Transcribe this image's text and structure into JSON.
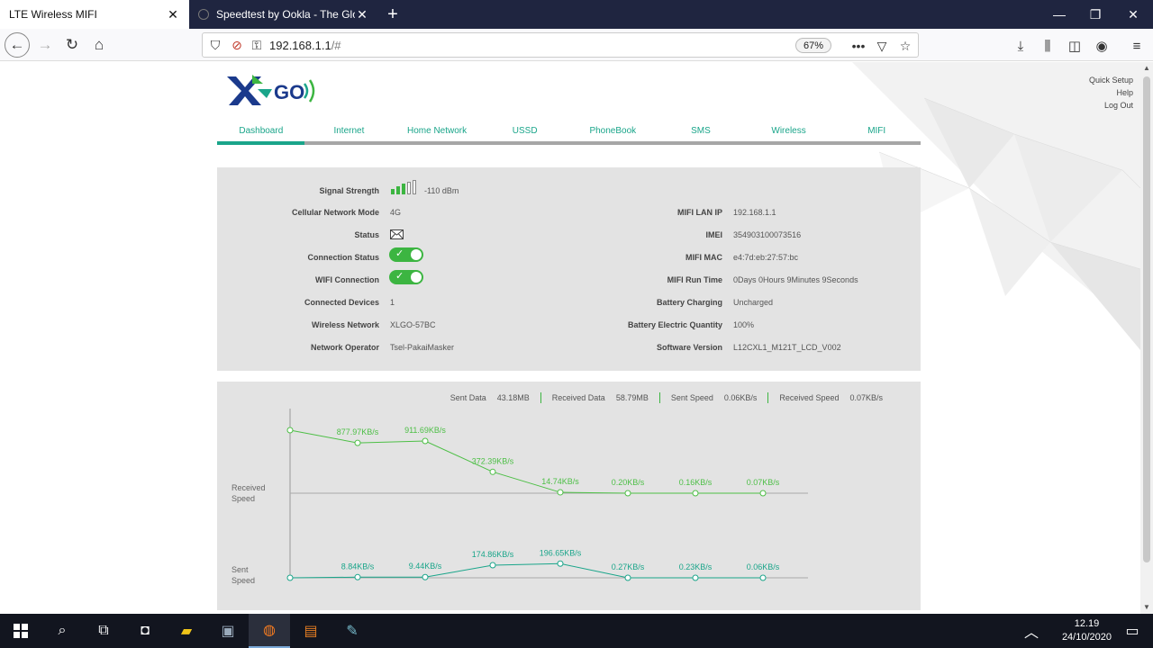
{
  "browser": {
    "tabs": [
      {
        "label": "LTE Wireless MIFI",
        "active": true
      },
      {
        "label": "Speedtest by Ookla - The Global",
        "active": false
      }
    ],
    "url_host": "192.168.1.1",
    "url_path": "/#",
    "zoom": "67%"
  },
  "site": {
    "brand": "GO",
    "toplinks": [
      "Quick Setup",
      "Help",
      "Log Out"
    ],
    "nav": [
      "Dashboard",
      "Internet",
      "Home Network",
      "USSD",
      "PhoneBook",
      "SMS",
      "Wireless",
      "MIFI"
    ],
    "active_nav": "Dashboard"
  },
  "info": {
    "signal_strength_label": "Signal Strength",
    "signal_value": "-110 dBm",
    "signal_bars_on": 3,
    "signal_bars_total": 5,
    "network_mode_label": "Cellular Network Mode",
    "network_mode": "4G",
    "status_label": "Status",
    "connection_status_label": "Connection Status",
    "connection_status_on": true,
    "wifi_connection_label": "WIFI Connection",
    "wifi_connection_on": true,
    "connected_devices_label": "Connected Devices",
    "connected_devices": "1",
    "wireless_network_label": "Wireless Network",
    "wireless_network": "XLGO-57BC",
    "network_operator_label": "Network Operator",
    "network_operator": "Tsel-PakaiMasker",
    "lan_ip_label": "MIFI LAN IP",
    "lan_ip": "192.168.1.1",
    "imei_label": "IMEI",
    "imei": "354903100073516",
    "mac_label": "MIFI MAC",
    "mac": "e4:7d:eb:27:57:bc",
    "runtime_label": "MIFI Run Time",
    "runtime": "0Days 0Hours 9Minutes 9Seconds",
    "battery_charging_label": "Battery Charging",
    "battery_charging": "Uncharged",
    "battery_quantity_label": "Battery Electric Quantity",
    "battery_quantity": "100%",
    "software_version_label": "Software Version",
    "software_version": "L12CXL1_M121T_LCD_V002"
  },
  "traffic": {
    "sent_data_label": "Sent Data",
    "sent_data": "43.18MB",
    "received_data_label": "Received Data",
    "received_data": "58.79MB",
    "sent_speed_label": "Sent Speed",
    "sent_speed": "0.06KB/s",
    "received_speed_label": "Received Speed",
    "received_speed": "0.07KB/s",
    "received_axis_label": [
      "Received",
      "Speed"
    ],
    "sent_axis_label": [
      "Sent",
      "Speed"
    ]
  },
  "chart_data": {
    "type": "line",
    "series": [
      {
        "values": [
          1100,
          877.97,
          911.69,
          372.39,
          14.74,
          0.2,
          0.16,
          0.07
        ],
        "labels": [
          "",
          "877.97KB/s",
          "911.69KB/s",
          "372.39KB/s",
          "14.74KB/s",
          "0.20KB/s",
          "0.16KB/s",
          "0.07KB/s"
        ],
        "color": "#4dbf46"
      },
      {
        "values": [
          0,
          8.84,
          9.44,
          174.86,
          196.65,
          0.27,
          0.23,
          0.06
        ],
        "labels": [
          "",
          "8.84KB/s",
          "9.44KB/s",
          "174.86KB/s",
          "196.65KB/s",
          "0.27KB/s",
          "0.23KB/s",
          "0.06KB/s"
        ],
        "color": "#1aa58a"
      }
    ]
  },
  "taskbar": {
    "time": "12.19",
    "date": "24/10/2020"
  }
}
